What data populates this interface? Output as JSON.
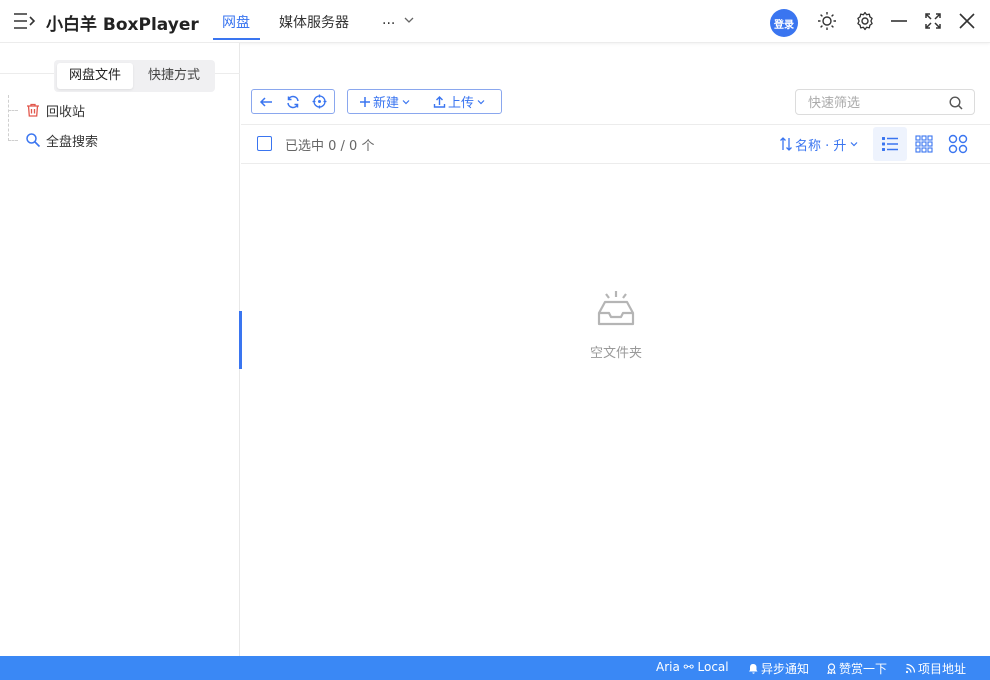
{
  "header": {
    "app_title": "小白羊 BoxPlayer",
    "tabs": [
      {
        "label": "网盘",
        "active": true
      },
      {
        "label": "媒体服务器",
        "active": false
      },
      {
        "label": "...",
        "active": false
      }
    ],
    "login_label": "登录"
  },
  "sidebar": {
    "segments": [
      {
        "label": "网盘文件",
        "active": true
      },
      {
        "label": "快捷方式",
        "active": false
      }
    ],
    "items": [
      {
        "label": "回收站",
        "icon": "trash-icon"
      },
      {
        "label": "全盘搜索",
        "icon": "search-icon"
      }
    ]
  },
  "toolbar": {
    "new_label": "新建",
    "upload_label": "上传",
    "search_placeholder": "快速筛选",
    "selection_text": "已选中 0 / 0 个",
    "sort_label": "名称 · 升"
  },
  "empty_state": {
    "text": "空文件夹"
  },
  "statusbar": {
    "aria": "Aria ⚯ Local",
    "notify": "异步通知",
    "donate": "赞赏一下",
    "project": "项目地址"
  },
  "colors": {
    "accent": "#3a75f0",
    "statusbar": "#3a88f5",
    "trash_icon": "#e2574c"
  }
}
